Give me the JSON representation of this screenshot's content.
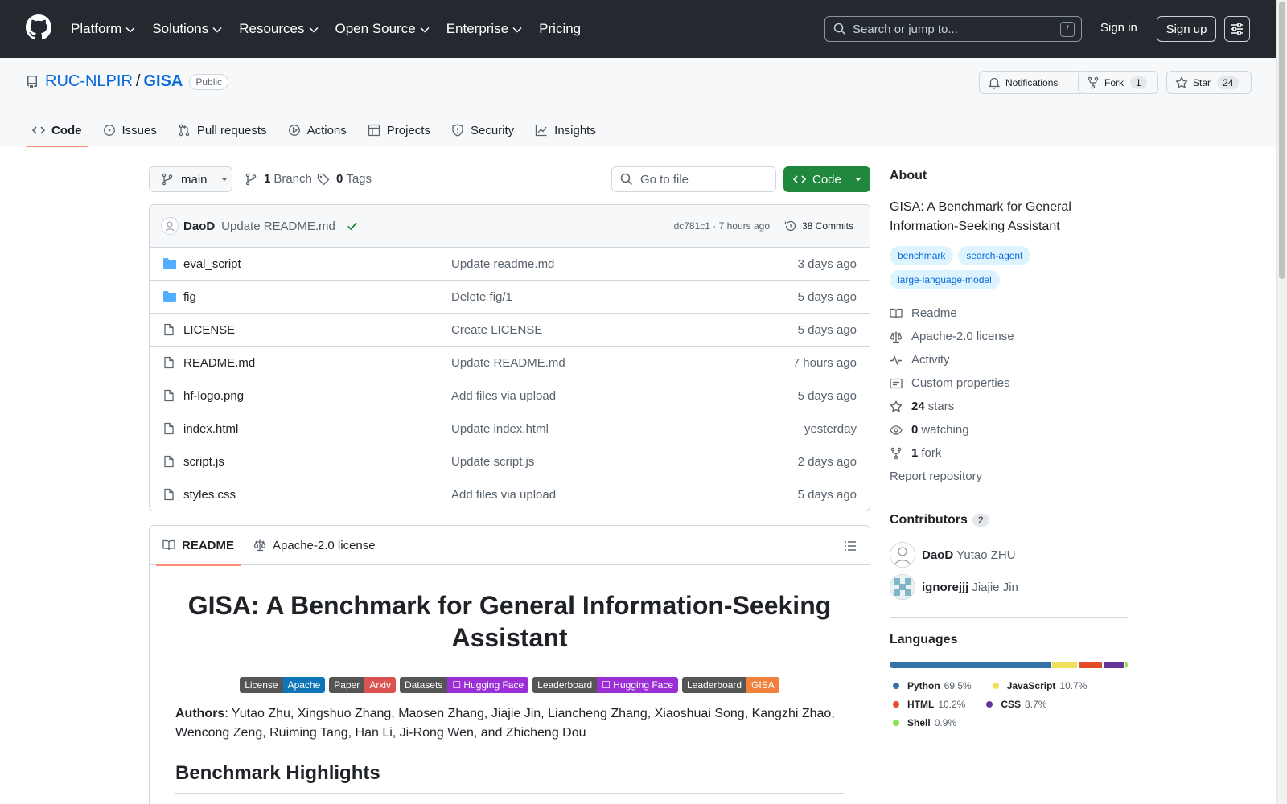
{
  "header": {
    "nav": [
      {
        "label": "Platform",
        "chevron": true
      },
      {
        "label": "Solutions",
        "chevron": true
      },
      {
        "label": "Resources",
        "chevron": true
      },
      {
        "label": "Open Source",
        "chevron": true
      },
      {
        "label": "Enterprise",
        "chevron": true
      },
      {
        "label": "Pricing",
        "chevron": false
      }
    ],
    "search_placeholder": "Search or jump to...",
    "search_shortcut": "/",
    "signin": "Sign in",
    "signup": "Sign up"
  },
  "repo": {
    "owner": "RUC-NLPIR",
    "separator": "/",
    "name": "GISA",
    "visibility": "Public",
    "notifications_label": "Notifications",
    "fork_label": "Fork",
    "fork_count": "1",
    "star_label": "Star",
    "star_count": "24",
    "tabs": [
      {
        "label": "Code",
        "icon": "code-icon",
        "selected": true
      },
      {
        "label": "Issues",
        "icon": "issue-icon",
        "selected": false
      },
      {
        "label": "Pull requests",
        "icon": "pull-request-icon",
        "selected": false
      },
      {
        "label": "Actions",
        "icon": "play-icon",
        "selected": false
      },
      {
        "label": "Projects",
        "icon": "table-icon",
        "selected": false
      },
      {
        "label": "Security",
        "icon": "shield-icon",
        "selected": false
      },
      {
        "label": "Insights",
        "icon": "graph-icon",
        "selected": false
      }
    ]
  },
  "toolbar": {
    "branch": "main",
    "branch_count": "1",
    "branch_label": "Branch",
    "tag_count": "0",
    "tag_label": "Tags",
    "go_to_file": "Go to file",
    "code_button": "Code"
  },
  "latest_commit": {
    "author": "DaoD",
    "message": "Update README.md",
    "hash_time": "dc781c1 · 7 hours ago",
    "commits": "38 Commits"
  },
  "files": [
    {
      "name": "eval_script",
      "type": "dir",
      "message": "Update readme.md",
      "date": "3 days ago"
    },
    {
      "name": "fig",
      "type": "dir",
      "message": "Delete fig/1",
      "date": "5 days ago"
    },
    {
      "name": "LICENSE",
      "type": "file",
      "message": "Create LICENSE",
      "date": "5 days ago"
    },
    {
      "name": "README.md",
      "type": "file",
      "message": "Update README.md",
      "date": "7 hours ago"
    },
    {
      "name": "hf-logo.png",
      "type": "file",
      "message": "Add files via upload",
      "date": "5 days ago"
    },
    {
      "name": "index.html",
      "type": "file",
      "message": "Update index.html",
      "date": "yesterday"
    },
    {
      "name": "script.js",
      "type": "file",
      "message": "Update script.js",
      "date": "2 days ago"
    },
    {
      "name": "styles.css",
      "type": "file",
      "message": "Add files via upload",
      "date": "5 days ago"
    }
  ],
  "readme": {
    "tab_readme": "README",
    "tab_license": "Apache-2.0 license",
    "title": "GISA: A Benchmark for General Information-Seeking Assistant",
    "shields": [
      {
        "key": "License",
        "value": "Apache",
        "color": "#0e75b6"
      },
      {
        "key": "Paper",
        "value": "Arxiv",
        "color": "#d9534f"
      },
      {
        "key": "Datasets",
        "value": "☐ Hugging Face",
        "color": "#9b2fd6"
      },
      {
        "key": "Leaderboard",
        "value": "☐ Hugging Face",
        "color": "#9b2fd6"
      },
      {
        "key": "Leaderboard",
        "value": "GISA",
        "color": "#f0803c"
      }
    ],
    "authors_label": "Authors",
    "authors_text": ": Yutao Zhu, Xingshuo Zhang, Maosen Zhang, Jiajie Jin, Liancheng Zhang, Xiaoshuai Song, Kangzhi Zhao, Wencong Zeng, Ruiming Tang, Han Li, Ji-Rong Wen, and Zhicheng Dou",
    "highlights_heading": "Benchmark Highlights"
  },
  "about": {
    "heading": "About",
    "description": "GISA: A Benchmark for General Information-Seeking Assistant",
    "topics": [
      "benchmark",
      "search-agent",
      "large-language-model"
    ],
    "links": {
      "readme": "Readme",
      "license": "Apache-2.0 license",
      "activity": "Activity",
      "custom_properties": "Custom properties",
      "stars_count": "24",
      "stars_label": "stars",
      "watching_count": "0",
      "watching_label": "watching",
      "fork_count": "1",
      "fork_label": "fork",
      "report": "Report repository"
    }
  },
  "contributors": {
    "heading": "Contributors",
    "count": "2",
    "list": [
      {
        "login": "DaoD",
        "name": "Yutao ZHU"
      },
      {
        "login": "ignorejjj",
        "name": "Jiajie Jin"
      }
    ]
  },
  "languages": {
    "heading": "Languages",
    "list": [
      {
        "name": "Python",
        "percent": "69.5%",
        "value": 69.5,
        "color": "#3572A5"
      },
      {
        "name": "JavaScript",
        "percent": "10.7%",
        "value": 10.7,
        "color": "#f1e05a"
      },
      {
        "name": "HTML",
        "percent": "10.2%",
        "value": 10.2,
        "color": "#e34c26"
      },
      {
        "name": "CSS",
        "percent": "8.7%",
        "value": 8.7,
        "color": "#663399"
      },
      {
        "name": "Shell",
        "percent": "0.9%",
        "value": 0.9,
        "color": "#89e051"
      }
    ]
  }
}
